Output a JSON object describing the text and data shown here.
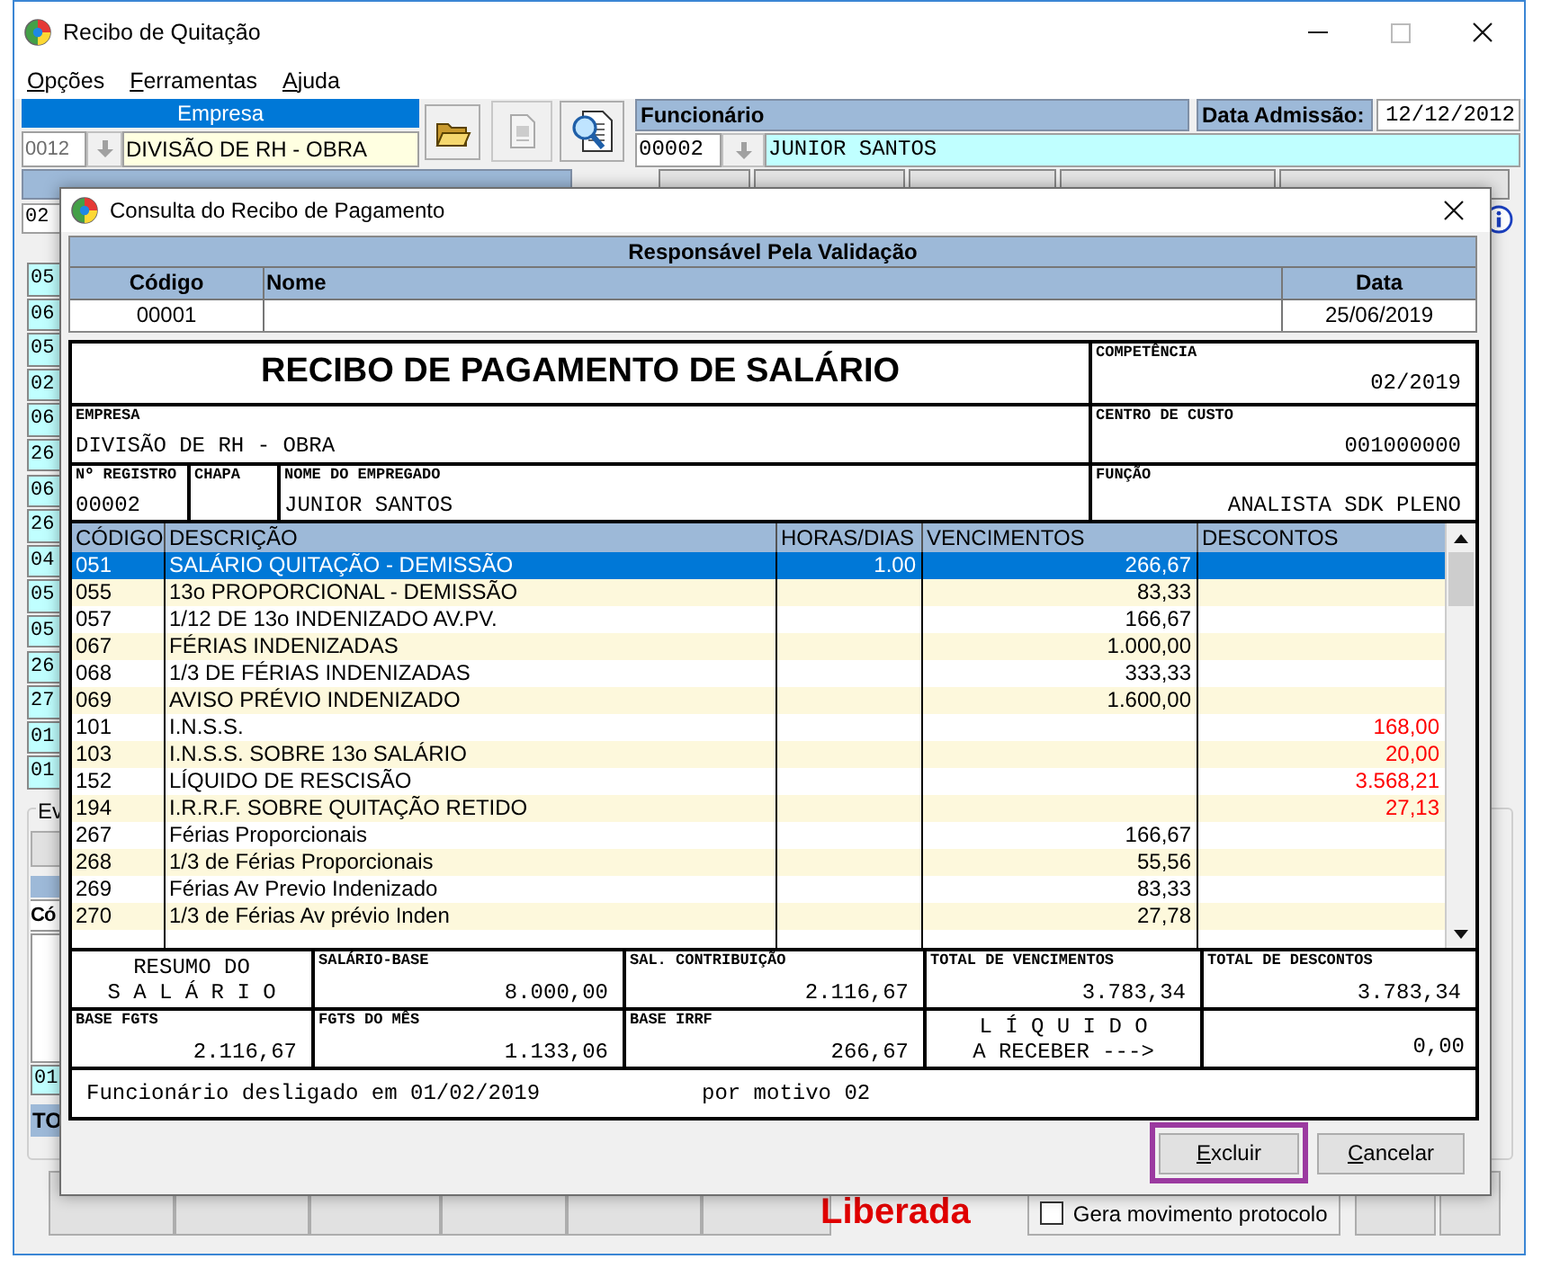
{
  "window": {
    "title": "Recibo de Quitação"
  },
  "menu": [
    "Opções",
    "Ferramentas",
    "Ajuda"
  ],
  "empresa": {
    "label": "Empresa",
    "code": "0012",
    "name": "DIVISÃO DE RH - OBRA"
  },
  "funcionario": {
    "label": "Funcionário",
    "code": "00002",
    "name": "JUNIOR SANTOS"
  },
  "admissao": {
    "label": "Data Admissão:",
    "value": "12/12/2012"
  },
  "motivo": {
    "code": "02"
  },
  "side_codes": [
    "05",
    "06",
    "05",
    "02",
    "06",
    "26",
    "06",
    "26",
    "04",
    "05",
    "05",
    "26",
    "27",
    "01",
    "01"
  ],
  "events": {
    "label": "Ev",
    "column": "Có",
    "code": "01",
    "total": "TO"
  },
  "status": "Liberada",
  "protocol": {
    "label": "Gera movimento protocolo",
    "checked": false
  },
  "dialog": {
    "title": "Consulta do Recibo de Pagamento",
    "validation": {
      "title": "Responsável Pela Validação",
      "columns": [
        "Código",
        "Nome",
        "Data"
      ],
      "code": "00001",
      "date": "25/06/2019"
    },
    "receipt_title": "RECIBO DE PAGAMENTO DE SALÁRIO",
    "competencia": {
      "label": "COMPETÊNCIA",
      "value": "02/2019"
    },
    "empresa": {
      "label": "EMPRESA",
      "value": "DIVISÃO DE RH - OBRA"
    },
    "centro_custo": {
      "label": "CENTRO DE CUSTO",
      "value": "001000000"
    },
    "registro": {
      "label": "Nº REGISTRO",
      "value": "00002"
    },
    "chapa": {
      "label": "CHAPA"
    },
    "empregado": {
      "label": "NOME DO EMPREGADO",
      "value": "JUNIOR SANTOS"
    },
    "funcao": {
      "label": "FUNÇÃO",
      "value": "ANALISTA SDK PLENO"
    },
    "columns": [
      "CÓDIGO",
      "DESCRIÇÃO",
      "HORAS/DIAS",
      "VENCIMENTOS",
      "DESCONTOS"
    ],
    "rows": [
      {
        "code": "051",
        "description": "SALÁRIO QUITAÇÃO - DEMISSÃO",
        "hours": "1.00",
        "earnings": "266,67",
        "selected": true
      },
      {
        "code": "055",
        "description": "13o PROPORCIONAL - DEMISSÃO",
        "earnings": "83,33",
        "selected": false
      },
      {
        "code": "057",
        "description": "1/12 DE 13o INDENIZADO AV.PV.",
        "earnings": "166,67",
        "selected": false
      },
      {
        "code": "067",
        "description": "FÉRIAS INDENIZADAS",
        "earnings": "1.000,00",
        "selected": false
      },
      {
        "code": "068",
        "description": "1/3 DE FÉRIAS INDENIZADAS",
        "earnings": "333,33",
        "selected": false
      },
      {
        "code": "069",
        "description": "AVISO PRÉVIO INDENIZADO",
        "earnings": "1.600,00",
        "selected": false
      },
      {
        "code": "101",
        "description": "I.N.S.S.",
        "deductions": "168,00",
        "selected": false
      },
      {
        "code": "103",
        "description": "I.N.S.S. SOBRE 13o SALÁRIO",
        "deductions": "20,00",
        "selected": false
      },
      {
        "code": "152",
        "description": "LÍQUIDO DE RESCISÃO",
        "deductions": "3.568,21",
        "selected": false
      },
      {
        "code": "194",
        "description": "I.R.R.F. SOBRE QUITAÇÃO RETIDO",
        "deductions": "27,13",
        "selected": false
      },
      {
        "code": "267",
        "description": "Férias Proporcionais",
        "earnings": "166,67",
        "selected": false
      },
      {
        "code": "268",
        "description": "1/3 de Férias Proporcionais",
        "earnings": "55,56",
        "selected": false
      },
      {
        "code": "269",
        "description": "Férias Av Previo Indenizado",
        "earnings": "83,33",
        "selected": false
      },
      {
        "code": "270",
        "description": "1/3 de Férias Av prévio Inden",
        "earnings": "27,78",
        "selected": false
      }
    ],
    "summary_title": [
      "RESUMO DO",
      "S A L Á R I O"
    ],
    "summary": [
      {
        "label": "SALÁRIO-BASE",
        "value": "8.000,00"
      },
      {
        "label": "SAL. CONTRIBUIÇÃO",
        "value": "2.116,67"
      },
      {
        "label": "TOTAL DE VENCIMENTOS",
        "value": "3.783,34"
      },
      {
        "label": "TOTAL DE DESCONTOS",
        "value": "3.783,34"
      },
      {
        "label": "BASE FGTS",
        "value": "2.116,67"
      },
      {
        "label": "FGTS DO MÊS",
        "value": "1.133,06"
      },
      {
        "label": "BASE IRRF",
        "value": "266,67"
      }
    ],
    "net_label": [
      "L Í Q U I D O",
      "A RECEBER --->"
    ],
    "net_value": "0,00",
    "note": [
      "Funcionário desligado em 01/02/2019",
      "por motivo 02"
    ],
    "buttons": [
      {
        "label": "Excluir",
        "highlighted": true
      },
      {
        "label": "Cancelar",
        "highlighted": false
      }
    ]
  }
}
